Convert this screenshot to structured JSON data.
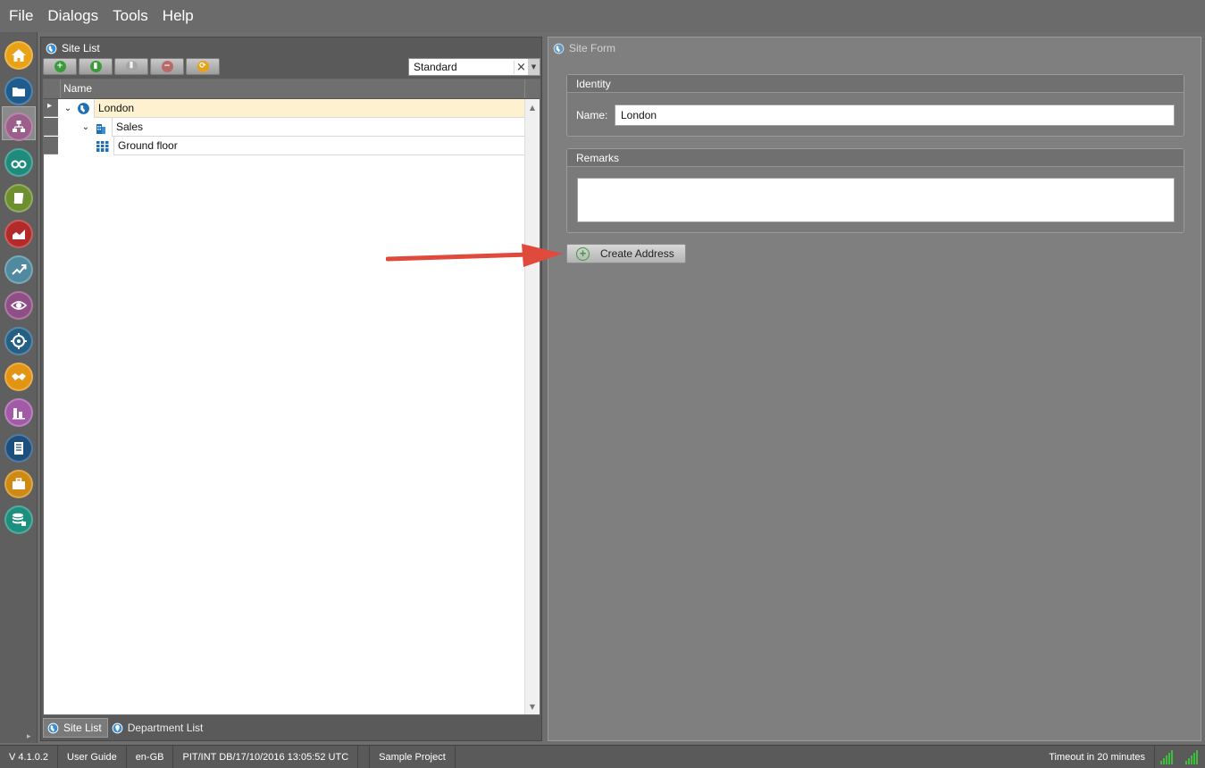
{
  "menu": {
    "items": [
      "File",
      "Dialogs",
      "Tools",
      "Help"
    ]
  },
  "rail": {
    "buttons": [
      {
        "name": "home-icon",
        "color": "#e9a116"
      },
      {
        "name": "folder-icon",
        "color": "#1e5b8e"
      },
      {
        "name": "org-chart-icon",
        "color": "#9c5f8c"
      },
      {
        "name": "binoculars-icon",
        "color": "#1f8b7d"
      },
      {
        "name": "scroll-icon",
        "color": "#6e8f2f"
      },
      {
        "name": "area-chart-icon",
        "color": "#b22a2a"
      },
      {
        "name": "trend-icon",
        "color": "#4f8aa0"
      },
      {
        "name": "eye-icon",
        "color": "#8f4f86"
      },
      {
        "name": "target-icon",
        "color": "#245f86"
      },
      {
        "name": "handshake-icon",
        "color": "#e29413"
      },
      {
        "name": "bar-chart-icon",
        "color": "#a25aa7"
      },
      {
        "name": "document-icon",
        "color": "#1c4f7e"
      },
      {
        "name": "briefcase-icon",
        "color": "#cf8a14"
      },
      {
        "name": "database-icon",
        "color": "#1c8f7e"
      }
    ]
  },
  "site_list": {
    "title": "Site List",
    "toolbar": {
      "buttons": [
        {
          "name": "add-site-icon",
          "color": "#3b9a3b",
          "glyph": "+"
        },
        {
          "name": "edit-icon",
          "color": "#3b9a3b",
          "glyph": "▮"
        },
        {
          "name": "columns-icon",
          "color": "#a5a5a5",
          "glyph": "⦀"
        },
        {
          "name": "remove-icon",
          "color": "#b86a6a",
          "glyph": "−"
        },
        {
          "name": "refresh-icon",
          "color": "#e6a11a",
          "glyph": "⟳"
        }
      ]
    },
    "view_select": {
      "value": "Standard"
    },
    "column_header": "Name",
    "tree": [
      {
        "label": "London",
        "level": 0,
        "icon": "globe-icon",
        "selected": true
      },
      {
        "label": "Sales",
        "level": 1,
        "icon": "building-icon",
        "selected": false
      },
      {
        "label": "Ground floor",
        "level": 2,
        "icon": "floor-icon",
        "selected": false
      }
    ],
    "bottom_tabs": [
      {
        "label": "Site List",
        "active": true
      },
      {
        "label": "Department List",
        "active": false
      }
    ]
  },
  "site_form": {
    "title": "Site Form",
    "identity": {
      "heading": "Identity",
      "name_label": "Name:",
      "name_value": "London"
    },
    "remarks": {
      "heading": "Remarks",
      "value": ""
    },
    "create_address_label": "Create Address"
  },
  "status_bar": {
    "version": "V 4.1.0.2",
    "user_guide": "User Guide",
    "locale": "en-GB",
    "db_info": "PIT/INT DB/17/10/2016 13:05:52 UTC",
    "project": "Sample Project",
    "timeout": "Timeout in 20 minutes"
  },
  "colors": {
    "accent_green": "#3b9a3b",
    "annotation_red": "#e04a3c",
    "selection": "#fdf1cf"
  }
}
